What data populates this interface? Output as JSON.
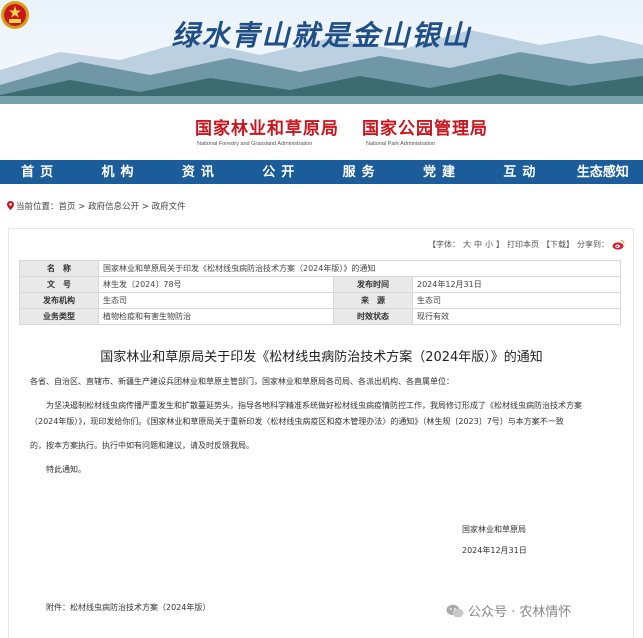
{
  "header": {
    "slogan": "绿水青山就是金山银山",
    "org_zh_1": "国家林业和草原局",
    "org_en_1": "National Forestry and Grassland Administration",
    "org_zh_2": "国家公园管理局",
    "org_en_2": "National Park Administration"
  },
  "nav": {
    "items": [
      "首页",
      "机构",
      "资讯",
      "公开",
      "服务",
      "党建",
      "互动",
      "生态感知"
    ]
  },
  "breadcrumb": {
    "prefix": "当前位置：",
    "items": [
      "首页",
      "政府信息公开",
      "政府文件"
    ],
    "sep": " > "
  },
  "tools": {
    "font_label": "【字体：",
    "font_large": "大",
    "font_medium": "中",
    "font_small": "小",
    "font_close": "】",
    "print_label": "打印本页",
    "download_label": "【下载】",
    "share_label": "分享到："
  },
  "meta": {
    "name_label": "名　称",
    "name_value": "国家林业和草原局关于印发《松材线虫病防治技术方案（2024年版）》的通知",
    "docno_label": "文　号",
    "docno_value": "林生发〔2024〕78号",
    "date_label": "发布时间",
    "date_value": "2024年12月31日",
    "issuer_label": "发布机构",
    "issuer_value": "生态司",
    "source_label": "来　源",
    "source_value": "生态司",
    "category_label": "业务类型",
    "category_value": "植物检疫和有害生物防治",
    "status_label": "时效状态",
    "status_value": "现行有效"
  },
  "document": {
    "title": "国家林业和草原局关于印发《松材线虫病防治技术方案（2024年版）》的通知",
    "recipients": "各省、自治区、直辖市、新疆生产建设兵团林业和草原主管部门，国家林业和草原局各司局、各派出机构、各直属单位：",
    "para1_line1": "为坚决遏制松材线虫病传播严重发生和扩散蔓延势头，指导各地科学精准系统做好松材线虫病疫情防控工作，我局修订形成了《松材线虫病防治技术方案",
    "para1_line2": "（2024年版）》，现印发给你们。《国家林业和草原局关于重新印发〈松材线虫病疫区和疫木管理办法〉的通知》（林生规〔2023〕7号）与本方案不一致",
    "para1_line3": "的，按本方案执行。执行中如有问题和建议，请及时反馈我局。",
    "closing": "特此通知。",
    "signer": "国家林业和草原局",
    "sign_date": "2024年12月31日",
    "attachment": "附件：松材线虫病防治技术方案（2024年版）"
  },
  "watermark": {
    "text": "公众号 · 农林情怀"
  },
  "colors": {
    "nav_bg": "#1b5d9b",
    "org_red": "#c9161e",
    "slogan_blue": "#1f4f86"
  }
}
